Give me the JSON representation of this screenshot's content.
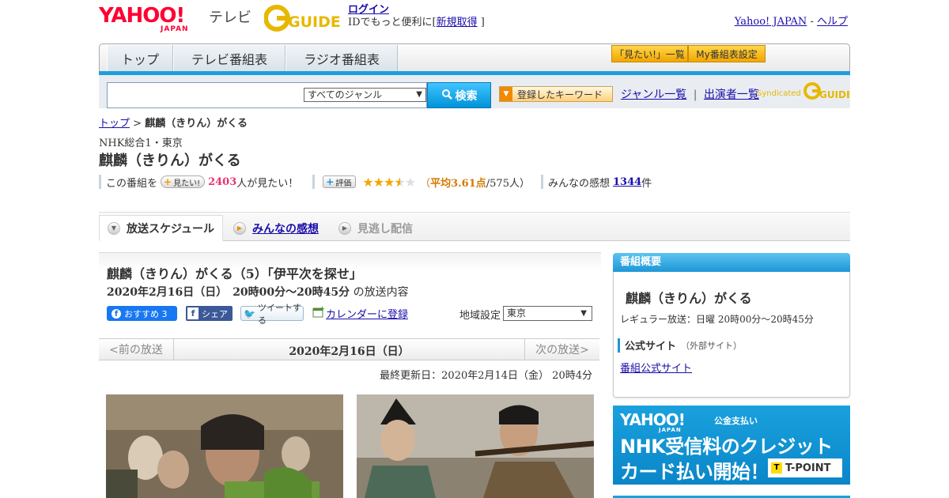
{
  "header": {
    "logo_text": "YAHOO!",
    "logo_sub": "JAPAN",
    "service": "テレビ",
    "gguide": "GUIDE",
    "login": "ログイン",
    "login_sub": "IDでもっと便利に[",
    "register": "新規取得",
    "login_close": "]",
    "yahoo_japan": "Yahoo! JAPAN",
    "help": "ヘルプ"
  },
  "nav": {
    "tabs": [
      "トップ",
      "テレビ番組表",
      "ラジオ番組表"
    ],
    "mitai_list": "「見たい!」一覧",
    "my_bangumi": "My番組表設定"
  },
  "search": {
    "genre": "すべてのジャンル",
    "button": "検索",
    "keyword_btn": "登録したキーワード",
    "genre_list": "ジャンル一覧",
    "performer_list": "出演者一覧",
    "syndicated": "Syndicated"
  },
  "breadcrumb": {
    "top": "トップ",
    "sep": ">",
    "current": "麒麟（きりん）がくる"
  },
  "program": {
    "channel": "NHK総合1・東京",
    "title": "麒麟（きりん）がくる",
    "want_prefix": "この番組を",
    "want_btn": "見たい!",
    "want_count": "2403",
    "want_suffix": "人が見たい！",
    "rate_btn": "評価",
    "rating": 3.61,
    "avg_open": "（",
    "avg_text": "平均3.61点",
    "avg_count": "/575人）",
    "impressions_label": "みんなの感想",
    "impressions_count": "1344",
    "impressions_unit": "件"
  },
  "tabs": {
    "schedule": "放送スケジュール",
    "impressions": "みんなの感想",
    "missed": "見逃し配信"
  },
  "episode": {
    "title": "麒麟（きりん）がくる（5）「伊平次を探せ」",
    "date": "2020年2月16日（日）　20時00分～20時45分",
    "date_suffix": "の放送内容",
    "fb_recommend": "おすすめ 3",
    "fb_share": "シェア",
    "tweet": "ツイートする",
    "calendar": "カレンダーに登録",
    "region_label": "地域設定",
    "region": "東京"
  },
  "pager": {
    "prev": "<前の放送",
    "date": "2020年2月16日（日）",
    "next": "次の放送>"
  },
  "updated": "最終更新日：2020年2月14日（金） 20時4分",
  "sidebar": {
    "head": "番組概要",
    "title": "麒麟（きりん）がくる",
    "regular": "レギュラー放送：日曜 20時00分～20時45分",
    "official": "公式サイト",
    "external": "（外部サイト）",
    "official_link": "番組公式サイト"
  },
  "banner": {
    "yahoo": "YAHOO!",
    "japan": "JAPAN",
    "kobai": "公金支払い",
    "line1": "NHK受信料のクレジット",
    "line2": "カード払い開始！",
    "tpoint_t": "T",
    "tpoint": "T-POINT"
  },
  "colors": {
    "accent_blue": "#1e9fdc",
    "pink": "#e8336f",
    "star": "#f3a600",
    "orange": "#f2a500"
  }
}
